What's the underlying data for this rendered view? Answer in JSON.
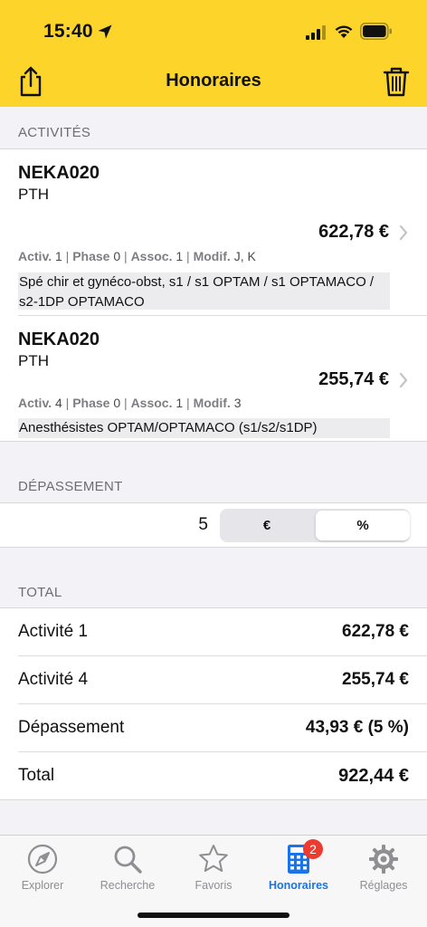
{
  "status": {
    "time": "15:40"
  },
  "nav": {
    "title": "Honoraires"
  },
  "sections": {
    "activities_header": "ACTIVITÉS",
    "depassement_header": "DÉPASSEMENT",
    "total_header": "TOTAL"
  },
  "activities": [
    {
      "code": "NEKA020",
      "label": "PTH",
      "price": "622,78 €",
      "activ_label": "Activ.",
      "activ_value": "1",
      "phase_label": "Phase",
      "phase_value": "0",
      "assoc_label": "Assoc.",
      "assoc_value": "1",
      "modif_label": "Modif.",
      "modif_value": "J, K",
      "note": "Spé chir et gynéco-obst, s1 /  s1 OPTAM / s1 OPTAMACO / s2-1DP OPTAMACO"
    },
    {
      "code": "NEKA020",
      "label": "PTH",
      "price": "255,74 €",
      "activ_label": "Activ.",
      "activ_value": "4",
      "phase_label": "Phase",
      "phase_value": "0",
      "assoc_label": "Assoc.",
      "assoc_value": "1",
      "modif_label": "Modif.",
      "modif_value": "3",
      "note": "Anesthésistes OPTAM/OPTAMACO (s1/s2/s1DP)"
    }
  ],
  "depassement": {
    "value": "5",
    "options": [
      "€",
      "%"
    ],
    "selected": "%"
  },
  "totals": [
    {
      "label": "Activité 1",
      "value": "622,78 €"
    },
    {
      "label": "Activité 4",
      "value": "255,74 €"
    },
    {
      "label": "Dépassement",
      "value": "43,93 € (5 %)"
    },
    {
      "label": "Total",
      "value": "922,44 €"
    }
  ],
  "tabs": [
    {
      "label": "Explorer",
      "icon": "compass-icon"
    },
    {
      "label": "Recherche",
      "icon": "magnifier-icon"
    },
    {
      "label": "Favoris",
      "icon": "star-icon"
    },
    {
      "label": "Honoraires",
      "icon": "calculator-icon",
      "badge": "2",
      "active": true
    },
    {
      "label": "Réglages",
      "icon": "gear-icon"
    }
  ],
  "colors": {
    "header": "#fdd42a",
    "accent": "#1a73e8",
    "badge": "#ee3b30"
  }
}
